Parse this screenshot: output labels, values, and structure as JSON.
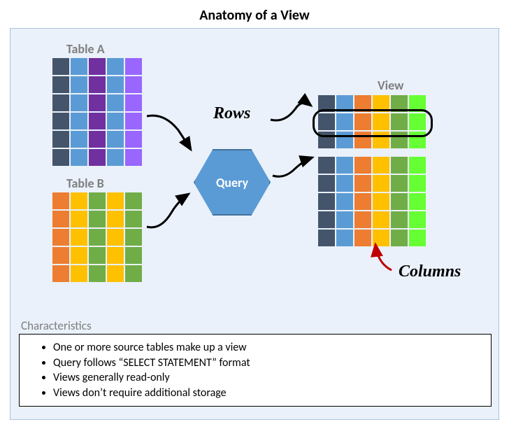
{
  "title": "Anatomy of a View",
  "labels": {
    "tableA": "Table A",
    "tableB": "Table B",
    "view": "View",
    "rows": "Rows",
    "columns": "Columns",
    "query": "Query",
    "characteristics": "Characteristics"
  },
  "characteristics": {
    "items": [
      "One or more source tables make up a view",
      "Query follows “SELECT STATEMENT” format",
      "Views generally read-only",
      "Views don’t require additional storage"
    ]
  },
  "chart_data": {
    "type": "diagram",
    "description": "Conceptual diagram of a database View composed from source tables via a query",
    "tableA": {
      "rows": 6,
      "cols": 5,
      "pattern": [
        "navy",
        "blue",
        "purple",
        "blue",
        "lpurple"
      ]
    },
    "tableB": {
      "rows": 5,
      "cols": 5,
      "pattern": [
        "orange",
        "yellow",
        "green",
        "yellow",
        "green"
      ]
    },
    "view": {
      "rows": 8,
      "cols": 6,
      "pattern": [
        "navy",
        "blue",
        "orange",
        "yellow",
        "green",
        "lgreen"
      ],
      "separator_after_row": 3
    },
    "annotations": [
      "Rows",
      "Columns"
    ]
  }
}
